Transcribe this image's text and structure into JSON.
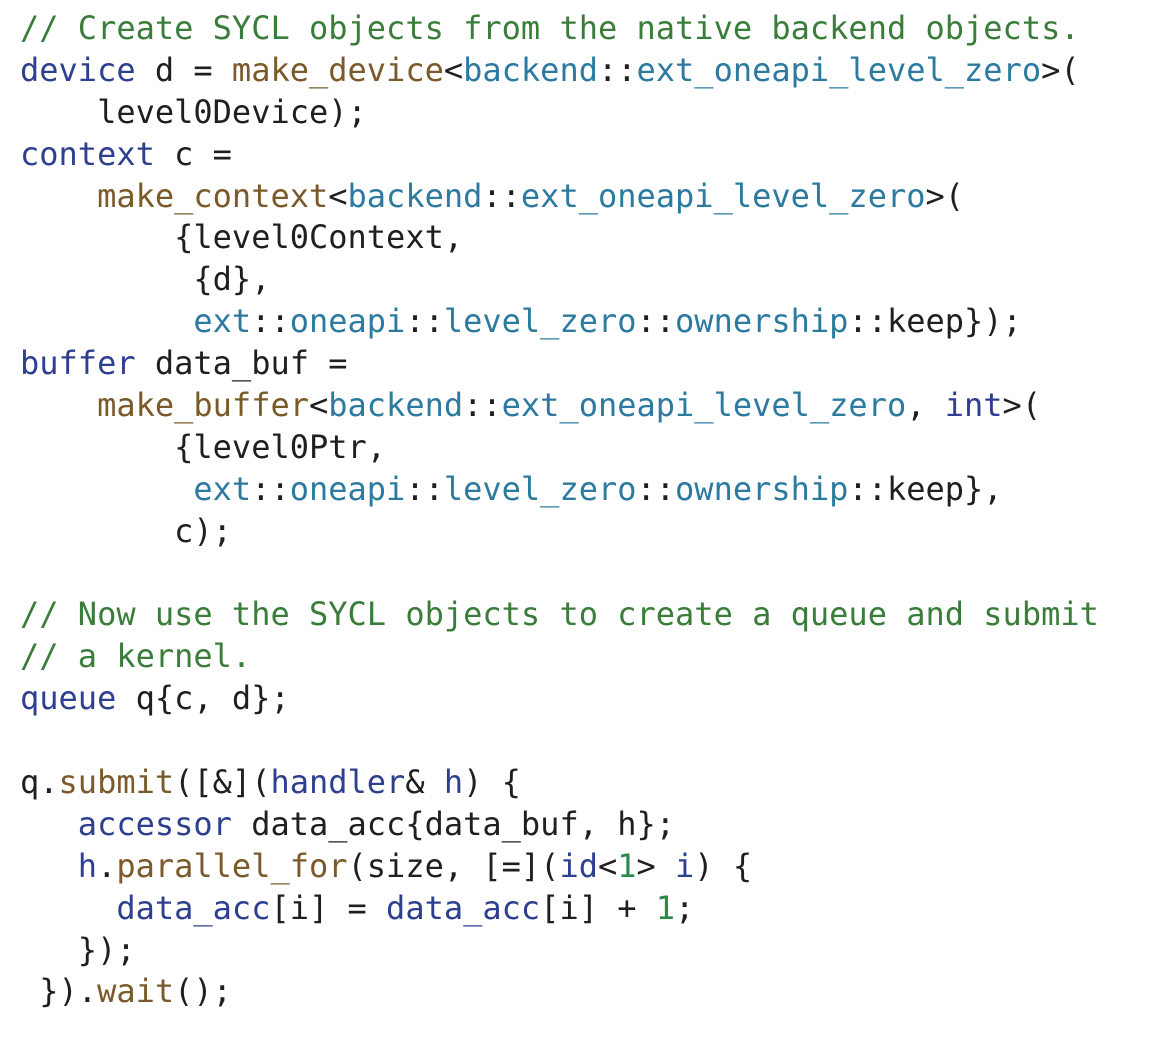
{
  "colors": {
    "comment": "#3a7d3a",
    "keyword": "#2f3f8f",
    "function": "#7a5a2a",
    "namespace": "#2c7aa0",
    "number": "#2a8a4a",
    "plain": "#1f1f1f"
  },
  "code_lines": [
    [
      {
        "t": "comment",
        "v": "// Create SYCL objects from the native backend objects."
      }
    ],
    [
      {
        "t": "keyword",
        "v": "device"
      },
      {
        "t": "plain",
        "v": " d = "
      },
      {
        "t": "function",
        "v": "make_device"
      },
      {
        "t": "plain",
        "v": "<"
      },
      {
        "t": "namespace",
        "v": "backend"
      },
      {
        "t": "plain",
        "v": "::"
      },
      {
        "t": "namespace",
        "v": "ext_oneapi_level_zero"
      },
      {
        "t": "plain",
        "v": ">("
      }
    ],
    [
      {
        "t": "plain",
        "v": "    level0Device);"
      }
    ],
    [
      {
        "t": "keyword",
        "v": "context"
      },
      {
        "t": "plain",
        "v": " c ="
      }
    ],
    [
      {
        "t": "plain",
        "v": "    "
      },
      {
        "t": "function",
        "v": "make_context"
      },
      {
        "t": "plain",
        "v": "<"
      },
      {
        "t": "namespace",
        "v": "backend"
      },
      {
        "t": "plain",
        "v": "::"
      },
      {
        "t": "namespace",
        "v": "ext_oneapi_level_zero"
      },
      {
        "t": "plain",
        "v": ">("
      }
    ],
    [
      {
        "t": "plain",
        "v": "        {level0Context,"
      }
    ],
    [
      {
        "t": "plain",
        "v": "         {d},"
      }
    ],
    [
      {
        "t": "plain",
        "v": "         "
      },
      {
        "t": "namespace",
        "v": "ext"
      },
      {
        "t": "plain",
        "v": "::"
      },
      {
        "t": "namespace",
        "v": "oneapi"
      },
      {
        "t": "plain",
        "v": "::"
      },
      {
        "t": "namespace",
        "v": "level_zero"
      },
      {
        "t": "plain",
        "v": "::"
      },
      {
        "t": "namespace",
        "v": "ownership"
      },
      {
        "t": "plain",
        "v": "::keep});"
      }
    ],
    [
      {
        "t": "keyword",
        "v": "buffer"
      },
      {
        "t": "plain",
        "v": " data_buf ="
      }
    ],
    [
      {
        "t": "plain",
        "v": "    "
      },
      {
        "t": "function",
        "v": "make_buffer"
      },
      {
        "t": "plain",
        "v": "<"
      },
      {
        "t": "namespace",
        "v": "backend"
      },
      {
        "t": "plain",
        "v": "::"
      },
      {
        "t": "namespace",
        "v": "ext_oneapi_level_zero"
      },
      {
        "t": "plain",
        "v": ", "
      },
      {
        "t": "keyword",
        "v": "int"
      },
      {
        "t": "plain",
        "v": ">("
      }
    ],
    [
      {
        "t": "plain",
        "v": "        {level0Ptr,"
      }
    ],
    [
      {
        "t": "plain",
        "v": "         "
      },
      {
        "t": "namespace",
        "v": "ext"
      },
      {
        "t": "plain",
        "v": "::"
      },
      {
        "t": "namespace",
        "v": "oneapi"
      },
      {
        "t": "plain",
        "v": "::"
      },
      {
        "t": "namespace",
        "v": "level_zero"
      },
      {
        "t": "plain",
        "v": "::"
      },
      {
        "t": "namespace",
        "v": "ownership"
      },
      {
        "t": "plain",
        "v": "::keep},"
      }
    ],
    [
      {
        "t": "plain",
        "v": "        c);"
      }
    ],
    [],
    [
      {
        "t": "comment",
        "v": "// Now use the SYCL objects to create a queue and submit"
      }
    ],
    [
      {
        "t": "comment",
        "v": "// a kernel."
      }
    ],
    [
      {
        "t": "keyword",
        "v": "queue"
      },
      {
        "t": "plain",
        "v": " q{c, d};"
      }
    ],
    [],
    [
      {
        "t": "plain",
        "v": "q."
      },
      {
        "t": "function",
        "v": "submit"
      },
      {
        "t": "plain",
        "v": "([&]("
      },
      {
        "t": "keyword",
        "v": "handler"
      },
      {
        "t": "plain",
        "v": "& "
      },
      {
        "t": "keyword",
        "v": "h"
      },
      {
        "t": "plain",
        "v": ") {"
      }
    ],
    [
      {
        "t": "plain",
        "v": "   "
      },
      {
        "t": "keyword",
        "v": "accessor"
      },
      {
        "t": "plain",
        "v": " data_acc{data_buf, h};"
      }
    ],
    [
      {
        "t": "plain",
        "v": "   "
      },
      {
        "t": "keyword",
        "v": "h"
      },
      {
        "t": "plain",
        "v": "."
      },
      {
        "t": "function",
        "v": "parallel_for"
      },
      {
        "t": "plain",
        "v": "(size, [=]("
      },
      {
        "t": "keyword",
        "v": "id"
      },
      {
        "t": "plain",
        "v": "<"
      },
      {
        "t": "number",
        "v": "1"
      },
      {
        "t": "plain",
        "v": "> "
      },
      {
        "t": "keyword",
        "v": "i"
      },
      {
        "t": "plain",
        "v": ") {"
      }
    ],
    [
      {
        "t": "plain",
        "v": "     "
      },
      {
        "t": "keyword",
        "v": "data_acc"
      },
      {
        "t": "plain",
        "v": "[i] = "
      },
      {
        "t": "keyword",
        "v": "data_acc"
      },
      {
        "t": "plain",
        "v": "[i] + "
      },
      {
        "t": "number",
        "v": "1"
      },
      {
        "t": "plain",
        "v": ";"
      }
    ],
    [
      {
        "t": "plain",
        "v": "   });"
      }
    ],
    [
      {
        "t": "plain",
        "v": " })."
      },
      {
        "t": "function",
        "v": "wait"
      },
      {
        "t": "plain",
        "v": "();"
      }
    ]
  ]
}
